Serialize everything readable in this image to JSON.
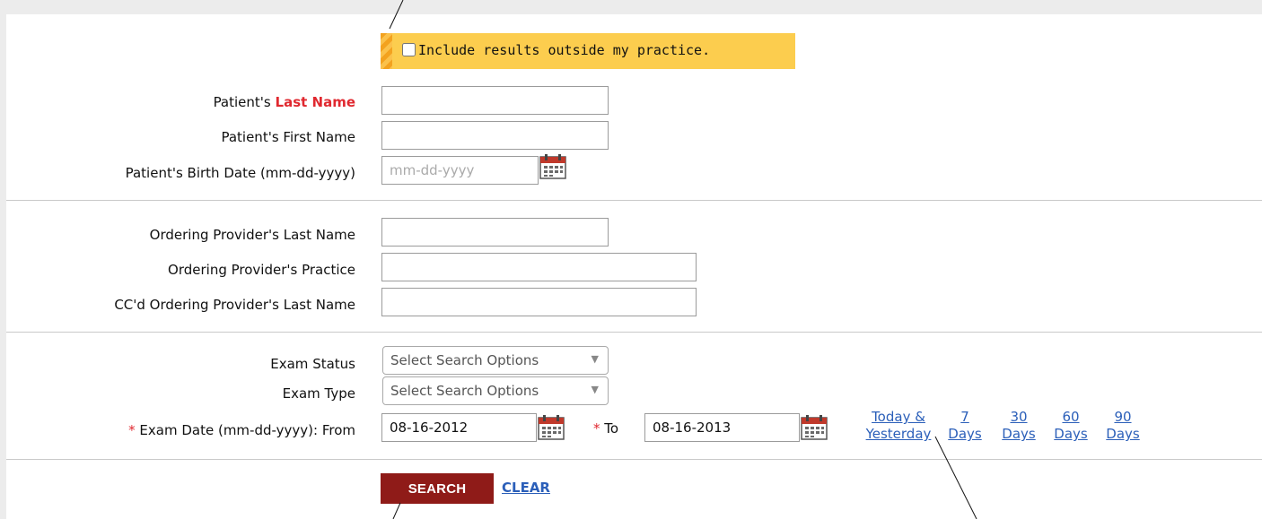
{
  "practice_filter": {
    "checkbox_label": "Include results outside my practice.",
    "checked": false
  },
  "patient": {
    "last_name_prefix": "Patient's",
    "last_name_emphasis": "Last Name",
    "first_name_label": "Patient's First Name",
    "birth_date_label": "Patient's Birth Date (mm-dd-yyyy)",
    "birth_date_placeholder": "mm-dd-yyyy"
  },
  "provider": {
    "last_name_label": "Ordering Provider's Last Name",
    "practice_label": "Ordering Provider's Practice",
    "cc_last_name_label": "CC'd Ordering Provider's Last Name"
  },
  "exam": {
    "status_label": "Exam Status",
    "status_value": "Select Search Options",
    "type_label": "Exam Type",
    "type_value": "Select Search Options",
    "required_marker": "*",
    "date_from_label": "Exam Date (mm-dd-yyyy): From",
    "date_from_value": "08-16-2012",
    "date_to_label": "To",
    "date_to_value": "08-16-2013"
  },
  "quick_ranges": [
    {
      "line1": "Today &",
      "line2": "Yesterday"
    },
    {
      "line1": "7",
      "line2": "Days"
    },
    {
      "line1": "30",
      "line2": "Days"
    },
    {
      "line1": "60",
      "line2": "Days"
    },
    {
      "line1": "90",
      "line2": "Days"
    }
  ],
  "actions": {
    "search_label": "SEARCH",
    "clear_label": "CLEAR"
  },
  "icons": {
    "calendar": "calendar-icon",
    "dropdown": "chevron-down-icon"
  },
  "colors": {
    "required_red": "#e0282f",
    "banner_yellow": "#fccd4e",
    "search_button": "#8f1b18",
    "link_blue": "#2b5fb9"
  }
}
